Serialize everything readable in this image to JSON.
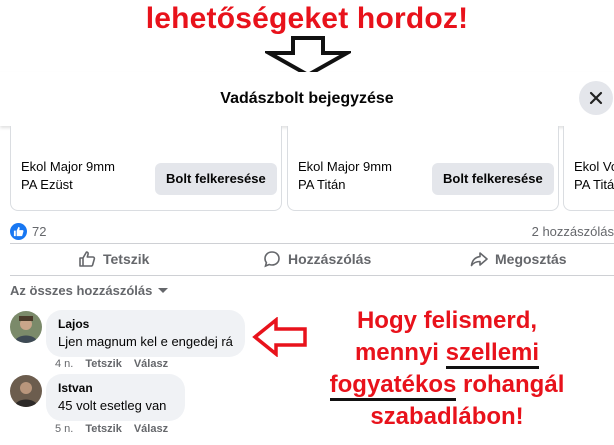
{
  "banner": {
    "text": "lehetőségeket hordoz!"
  },
  "header": {
    "title": "Vadászbolt bejegyzése"
  },
  "icons": {
    "close": "close-icon",
    "like": "thumbs-up-icon",
    "comment": "comment-icon",
    "share": "share-icon",
    "arrow_down": "down-arrow-icon",
    "arrow_left": "left-arrow-icon"
  },
  "products": [
    {
      "name": "Ekol Major 9mm\nPA Ezüst",
      "button": "Bolt felkeresése"
    },
    {
      "name": "Ekol Major 9mm\nPA Titán",
      "button": "Bolt felkeresése"
    },
    {
      "name": "Ekol Vo\nPA Titá",
      "button": ""
    }
  ],
  "reactions": {
    "count": "72",
    "comments": "2 hozzászólás"
  },
  "actions": {
    "like": "Tetszik",
    "comment": "Hozzászólás",
    "share": "Megosztás"
  },
  "filter": {
    "label": "Az összes hozzászólás"
  },
  "comments": [
    {
      "author": "Lajos",
      "text": "Ljen magnum kel e engedej rá",
      "time": "4 n.",
      "like": "Tetszik",
      "reply": "Válasz"
    },
    {
      "author": "Istvan",
      "text": "45 volt esetleg van",
      "time": "5 n.",
      "like": "Tetszik",
      "reply": "Válasz"
    }
  ],
  "note": {
    "line1": "Hogy felismerd,",
    "line2a": "mennyi ",
    "line2b": "szellemi",
    "line3a": "fogyatékos",
    "line3b": " rohangál",
    "line4": "szabadlábon!"
  },
  "colors": {
    "accent_red": "#e8121b",
    "facebook_blue": "#1877f2"
  }
}
